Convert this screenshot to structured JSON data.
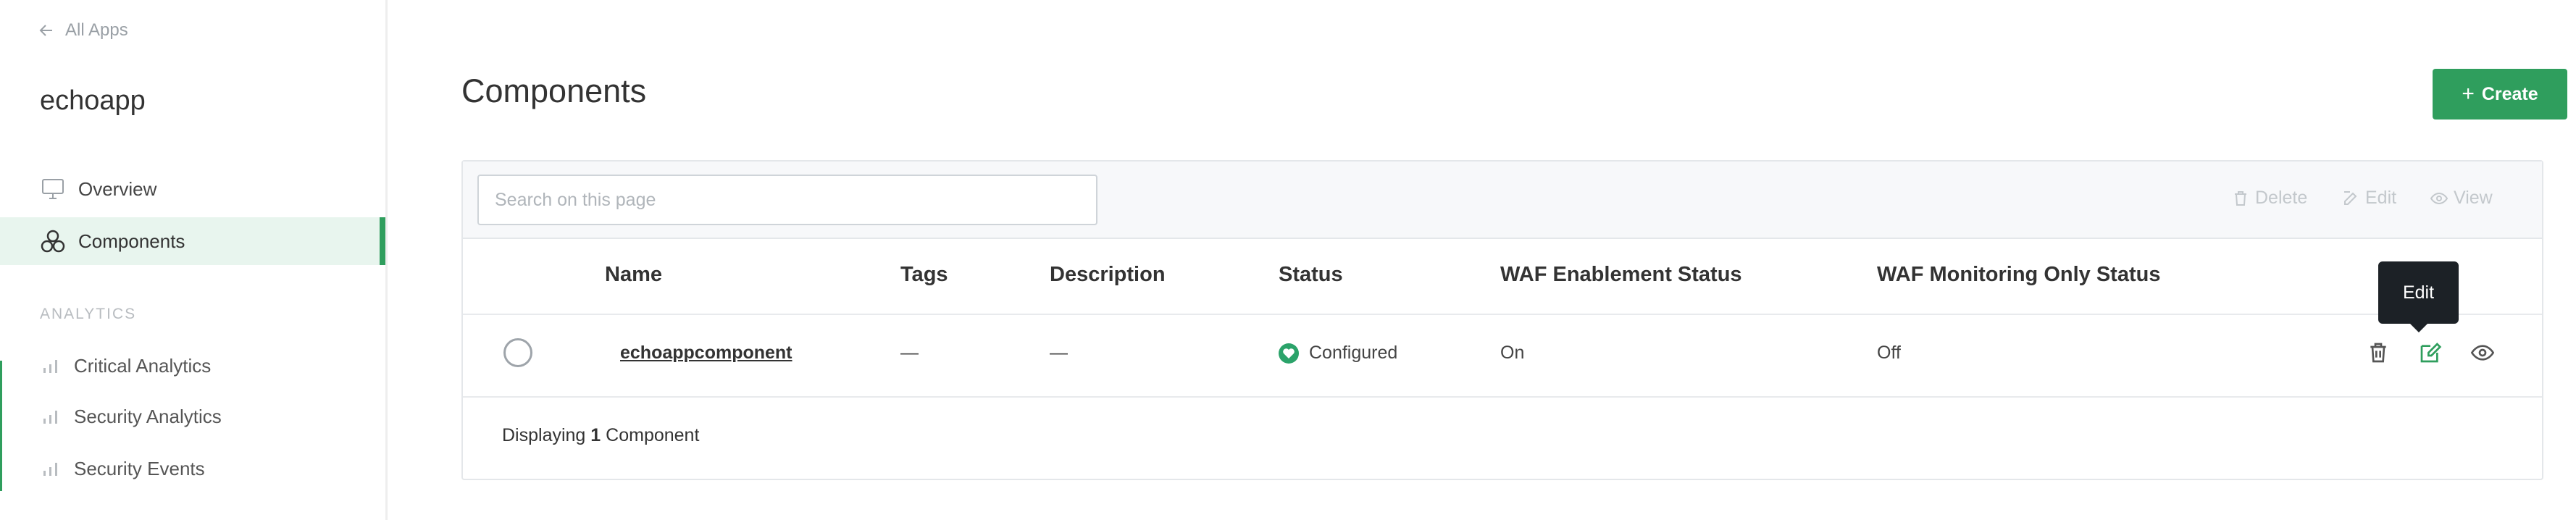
{
  "sidebar": {
    "back_label": "All Apps",
    "app_name": "echoapp",
    "nav": [
      {
        "label": "Overview",
        "icon": "monitor-icon"
      },
      {
        "label": "Components",
        "icon": "components-icon"
      }
    ],
    "section_label": "ANALYTICS",
    "analytics": [
      {
        "label": "Critical Analytics",
        "icon": "bar-chart-icon"
      },
      {
        "label": "Security Analytics",
        "icon": "bar-chart-icon"
      },
      {
        "label": "Security Events",
        "icon": "bar-chart-icon"
      }
    ]
  },
  "main": {
    "title": "Components",
    "create_label": "Create"
  },
  "toolbar": {
    "search_placeholder": "Search on this page",
    "delete_label": "Delete",
    "edit_label": "Edit",
    "view_label": "View"
  },
  "table": {
    "headers": [
      "Name",
      "Tags",
      "Description",
      "Status",
      "WAF Enablement Status",
      "WAF Monitoring Only Status"
    ],
    "rows": [
      {
        "name": "echoappcomponent",
        "tags": "—",
        "description": "—",
        "status": "Configured",
        "waf_enablement": "On",
        "waf_monitoring": "Off"
      }
    ],
    "footer_prefix": "Displaying",
    "footer_count": "1",
    "footer_suffix": "Component"
  },
  "tooltip": {
    "text": "Edit"
  },
  "colors": {
    "accent": "#2f9e5d",
    "status_ok": "#2ba36a"
  }
}
